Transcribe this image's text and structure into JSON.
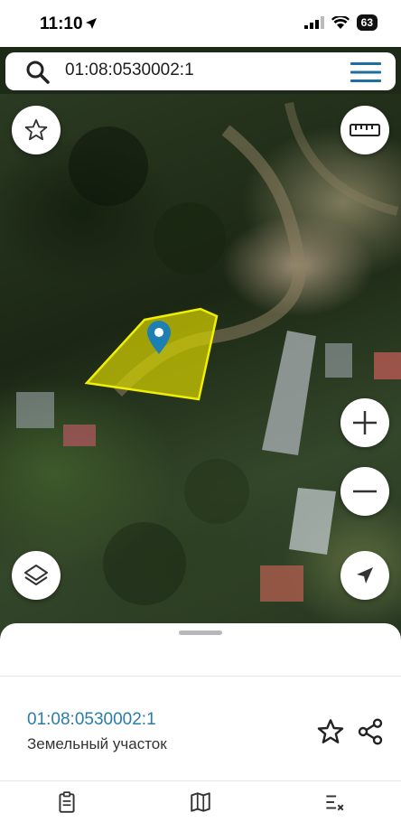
{
  "status_bar": {
    "time": "11:10",
    "battery": "63"
  },
  "search": {
    "query": "01:08:0530002:1"
  },
  "map": {
    "parcel_fill_color": "#d8d400",
    "marker_color": "#1e7fb3"
  },
  "sheet": {
    "parcel_number": "01:08:0530002:1",
    "parcel_type": "Земельный участок"
  },
  "colors": {
    "accent": "#2a7da8",
    "menu": "#1f6ea0"
  }
}
